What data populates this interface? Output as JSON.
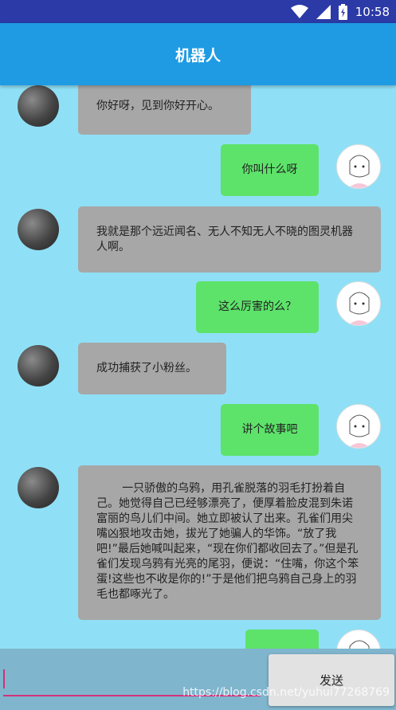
{
  "status_bar": {
    "time": "10:58",
    "icons": [
      "wifi-icon",
      "signal-icon",
      "battery-icon"
    ]
  },
  "app_bar": {
    "title": "机器人"
  },
  "messages": [
    {
      "sender": "robot",
      "text": "你好呀，见到你好开心。"
    },
    {
      "sender": "user",
      "text": "你叫什么呀"
    },
    {
      "sender": "robot",
      "text": "我就是那个远近闻名、无人不知无人不晓的图灵机器人啊。"
    },
    {
      "sender": "user",
      "text": "这么厉害的么？"
    },
    {
      "sender": "robot",
      "text": "成功捕获了小粉丝。"
    },
    {
      "sender": "user",
      "text": "讲个故事吧"
    },
    {
      "sender": "robot",
      "text": "一只骄傲的乌鸦，用孔雀脱落的羽毛打扮着自己。她觉得自己已经够漂亮了，便厚着脸皮混到朱诺富丽的鸟儿们中间。她立即被认了出来。孔雀们用尖嘴凶狠地攻击她，拔光了她骗人的华饰。“放了我吧!”最后她喊叫起来，“现在你们都收回去了。”但是孔雀们发现乌鸦有光亮的尾羽，便说：“住嘴，你这个笨蛋!这些也不收是你的!”于是他们把乌鸦自己身上的羽毛也都啄光了。"
    },
    {
      "sender": "user",
      "text": ""
    }
  ],
  "input": {
    "value": ""
  },
  "send_button": {
    "label": "发送"
  },
  "watermark": "https://blog.csdn.net/yuhui77268769",
  "colors": {
    "status_bar": "#2b3aa6",
    "app_bar": "#1e9be3",
    "chat_bg": "#8fe0f6",
    "robot_bubble": "#a7a7a7",
    "user_bubble": "#5de36a",
    "input_bar": "#7fb5cd",
    "accent": "#d1327a"
  }
}
